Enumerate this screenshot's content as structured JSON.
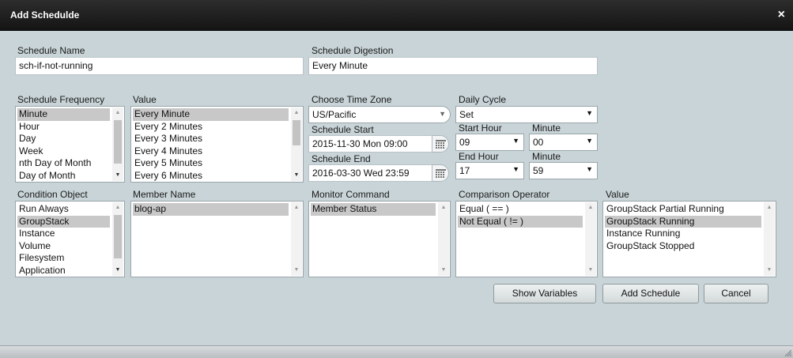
{
  "dialog": {
    "title": "Add Schedulde",
    "close_symbol": "×"
  },
  "schedule_name": {
    "label": "Schedule Name",
    "value": "sch-if-not-running"
  },
  "schedule_digestion": {
    "label": "Schedule Digestion",
    "value": "Every Minute"
  },
  "schedule_frequency": {
    "label": "Schedule Frequency",
    "items": [
      "Minute",
      "Hour",
      "Day",
      "Week",
      "nth Day of Month",
      "Day of Month"
    ],
    "selected_index": 0
  },
  "value_top": {
    "label": "Value",
    "items": [
      "Every Minute",
      "Every 2 Minutes",
      "Every 3 Minutes",
      "Every 4 Minutes",
      "Every 5 Minutes",
      "Every 6 Minutes"
    ],
    "selected_index": 0
  },
  "time_zone": {
    "label": "Choose Time Zone",
    "value": "US/Pacific"
  },
  "schedule_start": {
    "label": "Schedule Start",
    "value": "2015-11-30 Mon 09:00"
  },
  "schedule_end": {
    "label": "Schedule End",
    "value": "2016-03-30 Wed 23:59"
  },
  "daily_cycle": {
    "label": "Daily Cycle",
    "value": "Set",
    "start_hour_label": "Start Hour",
    "start_hour": "09",
    "start_minute_label": "Minute",
    "start_minute": "00",
    "end_hour_label": "End Hour",
    "end_hour": "17",
    "end_minute_label": "Minute",
    "end_minute": "59"
  },
  "condition_object": {
    "label": "Condition Object",
    "items": [
      "Run Always",
      "GroupStack",
      "Instance",
      "Volume",
      "Filesystem",
      "Application"
    ],
    "selected_index": 1
  },
  "member_name": {
    "label": "Member Name",
    "items": [
      "blog-ap"
    ],
    "selected_index": 0
  },
  "monitor_command": {
    "label": "Monitor Command",
    "items": [
      "Member Status"
    ],
    "selected_index": 0
  },
  "comparison_operator": {
    "label": "Comparison Operator",
    "items": [
      "Equal ( == )",
      "Not Equal ( != )"
    ],
    "selected_index": 1
  },
  "value_bottom": {
    "label": "Value",
    "items": [
      "GroupStack Partial Running",
      "GroupStack Running",
      "Instance Running",
      "GroupStack Stopped"
    ],
    "selected_index": 1
  },
  "buttons": {
    "show_variables": "Show Variables",
    "add_schedule": "Add Schedule",
    "cancel": "Cancel"
  },
  "colors": {
    "titlebar": "#1e1e1e",
    "body": "#c9d4d8",
    "selection": "#c8c8c8"
  }
}
